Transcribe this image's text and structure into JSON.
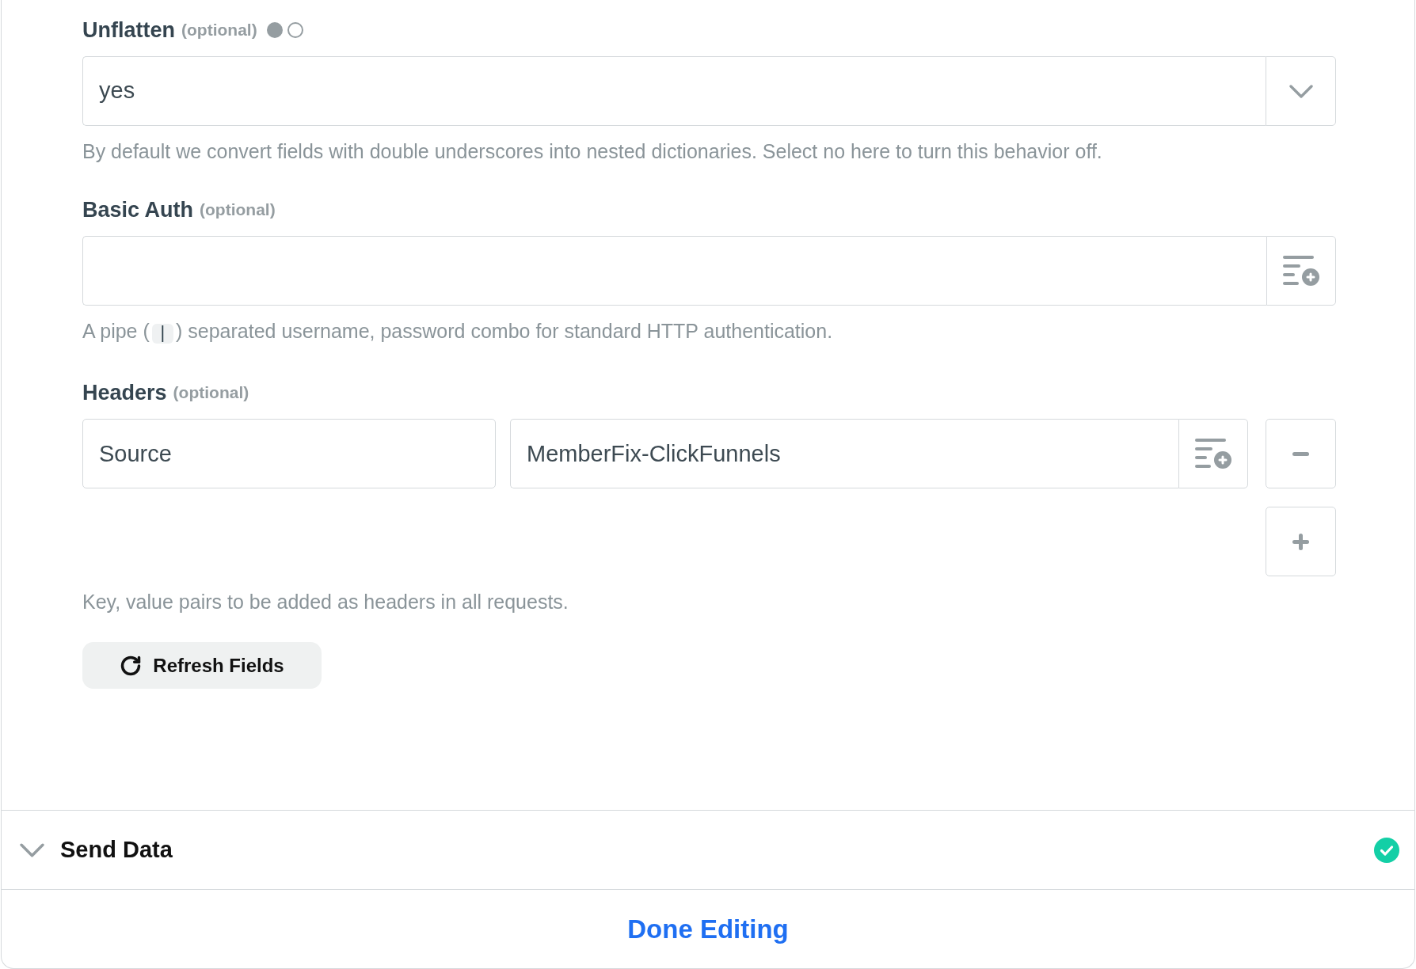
{
  "fields": [
    {
      "kind": "select",
      "label": "Unflatten",
      "optional": "(optional)",
      "dots": [
        {
          "filled": true
        },
        {
          "filled": false
        }
      ],
      "value": "yes",
      "help": [
        {
          "kind": "text",
          "text": "By default we convert fields with double underscores into nested dictionaries. Select no here to turn this behavior off."
        }
      ]
    },
    {
      "kind": "text",
      "label": "Basic Auth",
      "optional": "(optional)",
      "help": [
        {
          "kind": "text",
          "text": "A pipe ("
        },
        {
          "kind": "code",
          "text": "|"
        },
        {
          "kind": "text",
          "text": ") separated username, password combo for standard HTTP authentication."
        }
      ]
    },
    {
      "kind": "pairs",
      "label": "Headers",
      "optional": "(optional)",
      "rows": [
        {
          "key": "Source",
          "value": "MemberFix-ClickFunnels"
        }
      ],
      "help": [
        {
          "kind": "text",
          "text": "Key, value pairs to be added as headers in all requests."
        }
      ]
    }
  ],
  "refresh_button": {
    "label": "Refresh Fields"
  },
  "section": {
    "title": "Send Data",
    "complete": true
  },
  "done_button": {
    "label": "Done Editing"
  }
}
